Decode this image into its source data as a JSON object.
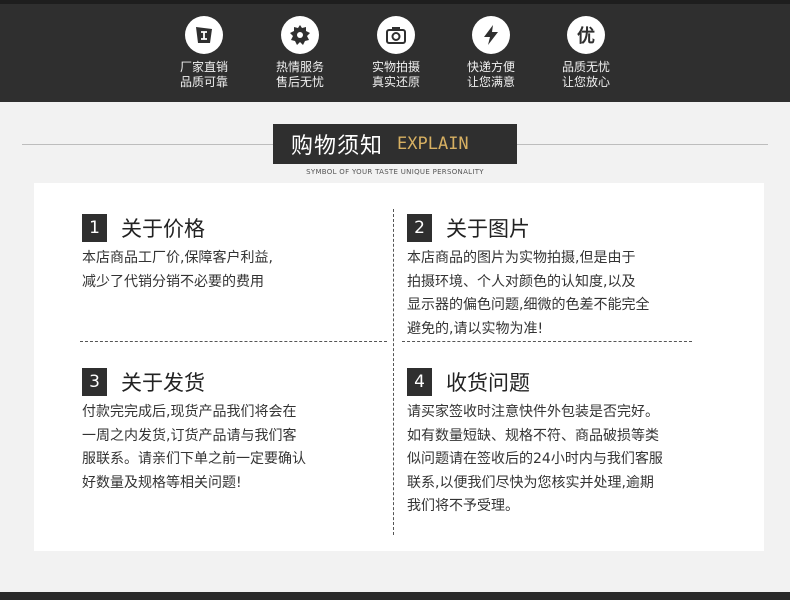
{
  "badges": [
    {
      "icon": "factory-badge-icon",
      "line1": "厂家直销",
      "line2": "品质可靠"
    },
    {
      "icon": "gear-icon",
      "line1": "热情服务",
      "line2": "售后无忧"
    },
    {
      "icon": "camera-icon",
      "line1": "实物拍摄",
      "line2": "真实还原"
    },
    {
      "icon": "lightning-icon",
      "line1": "快递方便",
      "line2": "让您满意"
    },
    {
      "icon": "quality-icon",
      "glyph": "优",
      "line1": "品质无忧",
      "line2": "让您放心"
    }
  ],
  "header": {
    "title_cn": "购物须知",
    "title_en": "EXPLAIN",
    "subtitle": "SYMBOL OF YOUR TASTE UNIQUE PERSONALITY"
  },
  "sections": [
    {
      "num": "1",
      "title": "关于价格",
      "lines": [
        "本店商品工厂价,保障客户利益,",
        "减少了代销分销不必要的费用"
      ]
    },
    {
      "num": "2",
      "title": "关于图片",
      "lines": [
        "本店商品的图片为实物拍摄,但是由于",
        "拍摄环境、个人对颜色的认知度,以及",
        "显示器的偏色问题,细微的色差不能完全",
        "避免的,请以实物为准!"
      ]
    },
    {
      "num": "3",
      "title": "关于发货",
      "lines": [
        "付款完完成后,现货产品我们将会在",
        "一周之内发货,订货产品请与我们客",
        "服联系。请亲们下单之前一定要确认",
        "好数量及规格等相关问题!"
      ]
    },
    {
      "num": "4",
      "title": "收货问题",
      "lines": [
        "请买家签收时注意快件外包装是否完好。",
        "如有数量短缺、规格不符、商品破损等类",
        "似问题请在签收后的24小时内与我们客服",
        "联系,以便我们尽快为您核实并处理,逾期",
        "我们将不予受理。"
      ]
    }
  ],
  "colors": {
    "dark": "#2f2f2f",
    "accent": "#d7b062",
    "panel": "#ffffff",
    "background": "#f2f2f2"
  }
}
